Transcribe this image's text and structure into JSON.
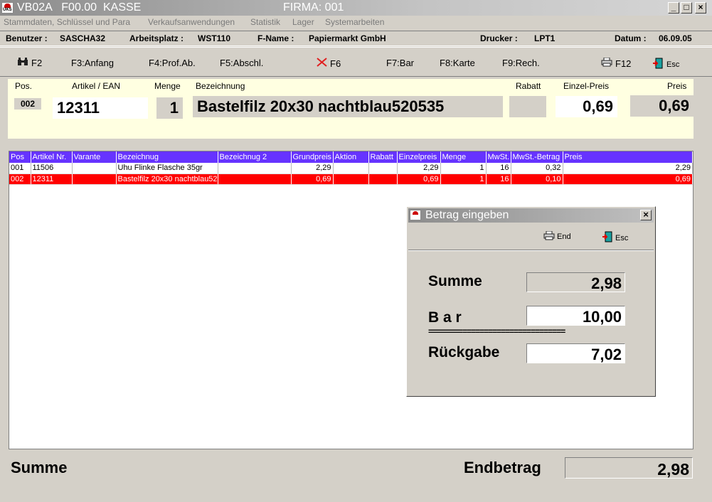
{
  "window": {
    "title": "VB02A   F00.00  KASSE",
    "firma": "FIRMA: 001",
    "min": "_",
    "max": "□",
    "close": "×"
  },
  "menu": [
    "Stammdaten, Schlüssel und Para",
    "Verkaufsanwendungen",
    "Statistik",
    "Lager",
    "Systemarbeiten"
  ],
  "info": {
    "benutzer_label": "Benutzer :",
    "benutzer": "SASCHA32",
    "arbeitsplatz_label": "Arbeitsplatz :",
    "arbeitsplatz": "WST110",
    "fname_label": "F-Name :",
    "fname": "Papiermarkt GmbH",
    "drucker_label": "Drucker :",
    "drucker": "LPT1",
    "datum_label": "Datum :",
    "datum": "06.09.05"
  },
  "toolbar": {
    "f2": "F2",
    "f3": "F3:Anfang",
    "f4": "F4:Prof.Ab.",
    "f5": "F5:Abschl.",
    "f6": "F6",
    "f7": "F7:Bar",
    "f8": "F8:Karte",
    "f9": "F9:Rech.",
    "f12": "F12",
    "esc": "Esc"
  },
  "entry": {
    "pos_label": "Pos.",
    "artikel_label": "Artikel / EAN",
    "menge_label": "Menge",
    "bez_label": "Bezeichnung",
    "rabatt_label": "Rabatt",
    "einzel_label": "Einzel-Preis",
    "preis_label": "Preis",
    "pos": "002",
    "artikel": "12311",
    "menge": "1",
    "bezeichnung": "Bastelfilz 20x30 nachtblau520535",
    "rabatt": "",
    "einzelpreis": "0,69",
    "preis": "0,69"
  },
  "table": {
    "columns": [
      "Pos",
      "Artikel Nr.",
      "Varante",
      "Bezeichnug",
      "Bezeichnug 2",
      "Grundpreis",
      "Aktion",
      "Rabatt",
      "Einzelpreis",
      "Menge",
      "MwSt.",
      "MwSt.-Betrag",
      "Preis"
    ],
    "rows": [
      [
        "001",
        "11506",
        "",
        "Uhu Flinke Flasche 35gr",
        "",
        "2,29",
        "",
        "",
        "2,29",
        "1",
        "16",
        "0,32",
        "2,29"
      ],
      [
        "002",
        "12311",
        "",
        "Bastelfilz 20x30 nachtblau52(",
        "",
        "0,69",
        "",
        "",
        "0,69",
        "1",
        "16",
        "0,10",
        "0,69"
      ]
    ]
  },
  "dialog": {
    "title": "Betrag eingeben",
    "close": "×",
    "end": "End",
    "esc": "Esc",
    "summe_label": "Summe",
    "summe": "2,98",
    "bar_label": "B a r",
    "bar": "10,00",
    "rule": "================================",
    "rueckgabe_label": "Rückgabe",
    "rueckgabe": "7,02"
  },
  "footer": {
    "summe_label": "Summe",
    "endbetrag_label": "Endbetrag",
    "endbetrag": "2,98"
  },
  "colors": {
    "header": "#6633ff",
    "selected_row": "#ff0000",
    "entry_bg": "#ffffe1",
    "face": "#d4d0c8"
  }
}
